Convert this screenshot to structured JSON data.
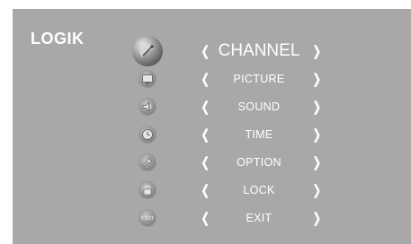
{
  "brand": {
    "logo_text": "LOGIK"
  },
  "menu": {
    "selected_index": 0,
    "left_arrow": "❬",
    "right_arrow": "❭",
    "items": [
      {
        "label": "CHANNEL",
        "icon": "satellite-dish-icon"
      },
      {
        "label": "PICTURE",
        "icon": "tv-screen-icon"
      },
      {
        "label": "SOUND",
        "icon": "speaker-icon"
      },
      {
        "label": "TIME",
        "icon": "clock-icon"
      },
      {
        "label": "OPTION",
        "icon": "wrench-icon"
      },
      {
        "label": "LOCK",
        "icon": "padlock-icon"
      },
      {
        "label": "EXIT",
        "icon": "exit-icon",
        "icon_text": "EXIT"
      }
    ]
  },
  "colors": {
    "background": "#a8a8a8",
    "text": "#ffffff"
  }
}
